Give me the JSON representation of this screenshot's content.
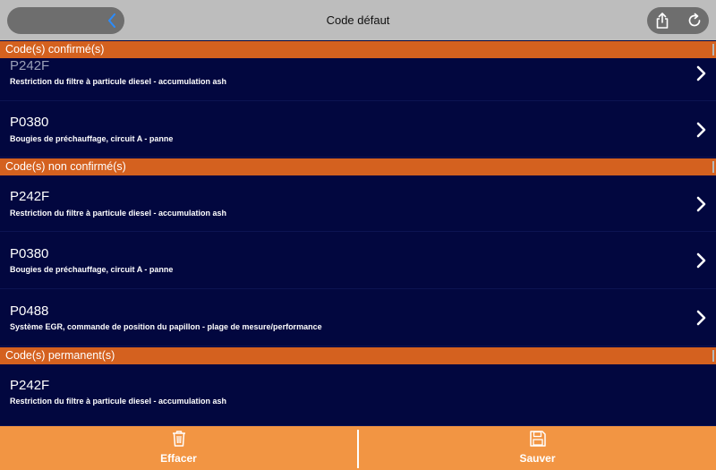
{
  "header": {
    "title": "Code défaut",
    "back_icon": "chevron-left-icon",
    "share_icon": "share-icon",
    "refresh_icon": "refresh-icon"
  },
  "sections": {
    "confirmed": {
      "label": "Code(s) confirmé(s)",
      "items": [
        {
          "code": "P242F",
          "description": "Restriction du filtre à particule diesel - accumulation ash"
        },
        {
          "code": "P0380",
          "description": "Bougies de préchauffage, circuit A - panne"
        }
      ]
    },
    "unconfirmed": {
      "label": "Code(s) non confirmé(s)",
      "items": [
        {
          "code": "P242F",
          "description": "Restriction du filtre à particule diesel - accumulation ash"
        },
        {
          "code": "P0380",
          "description": "Bougies de préchauffage, circuit A - panne"
        },
        {
          "code": "P0488",
          "description": "Système EGR, commande de position du papillon - plage de mesure/performance"
        }
      ]
    },
    "permanent": {
      "label": "Code(s) permanent(s)",
      "items": [
        {
          "code": "P242F",
          "description": "Restriction du filtre à particule diesel - accumulation ash"
        }
      ]
    }
  },
  "footer": {
    "clear_label": "Effacer",
    "clear_icon": "trash-icon",
    "save_label": "Sauver",
    "save_icon": "floppy-disk-icon"
  },
  "colors": {
    "section_header": "#d4611f",
    "list_background": "#02073f",
    "footer": "#f29543",
    "top_bar": "#bdbdbd"
  }
}
